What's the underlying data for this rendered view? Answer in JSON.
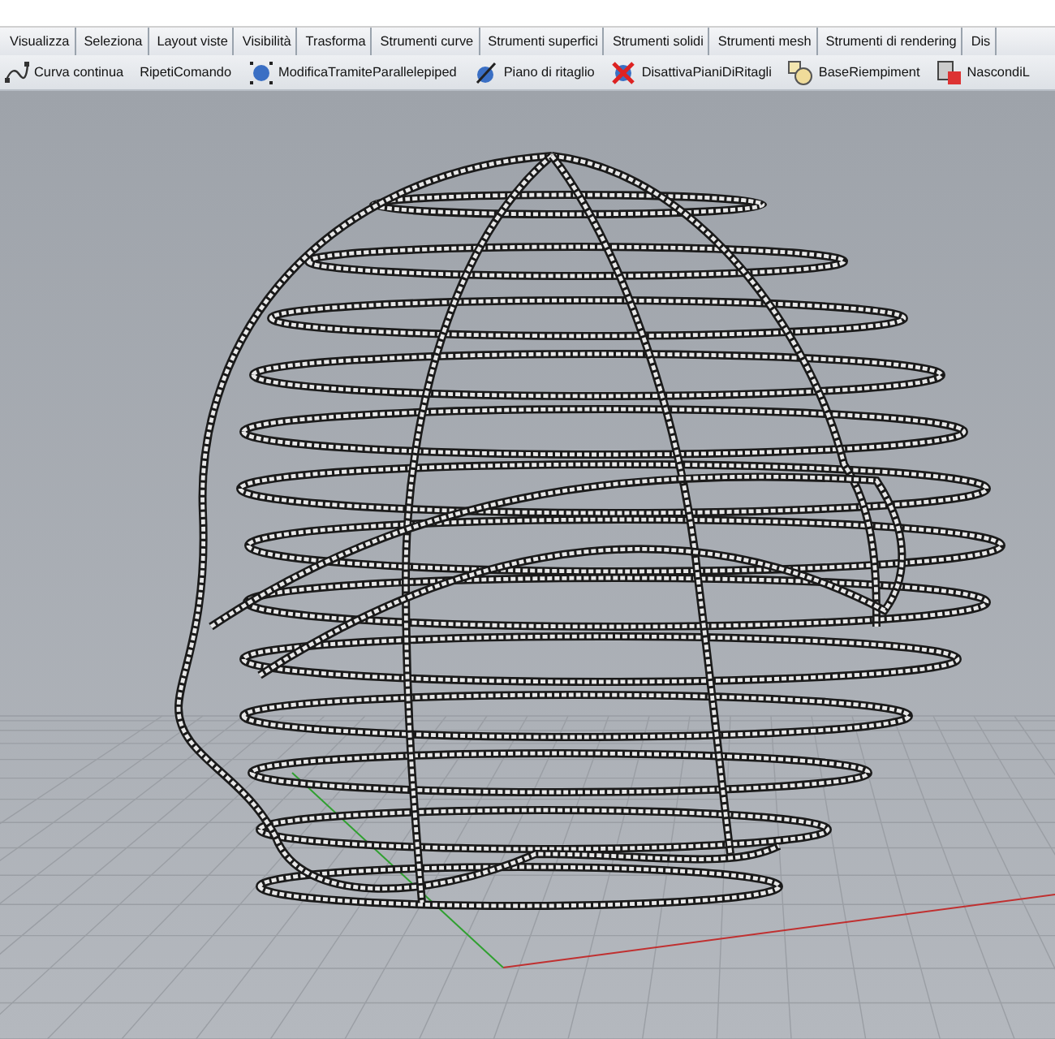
{
  "tabs": [
    {
      "label": "Visualizza",
      "selected": false
    },
    {
      "label": "Seleziona",
      "selected": false
    },
    {
      "label": "Layout viste",
      "selected": false
    },
    {
      "label": "Visibilità",
      "selected": false
    },
    {
      "label": "Trasforma",
      "selected": false
    },
    {
      "label": "Strumenti curve",
      "selected": false
    },
    {
      "label": "Strumenti superfici",
      "selected": false
    },
    {
      "label": "Strumenti solidi",
      "selected": false
    },
    {
      "label": "Strumenti mesh",
      "selected": false
    },
    {
      "label": "Strumenti di rendering",
      "selected": false
    },
    {
      "label": "Dis",
      "selected": false
    }
  ],
  "toolbar": [
    {
      "label": "Curva continua",
      "kind": "curve"
    },
    {
      "label": "RipetiComando",
      "kind": "none"
    },
    {
      "label": "ModificaTramiteParallelepiped",
      "kind": "cage"
    },
    {
      "label": "Piano di ritaglio",
      "kind": "clip"
    },
    {
      "label": "DisattivaPianiDiRitagli",
      "kind": "clipoff"
    },
    {
      "label": "BaseRiempiment",
      "kind": "fill"
    },
    {
      "label": "NascondiL",
      "kind": "hide"
    }
  ]
}
